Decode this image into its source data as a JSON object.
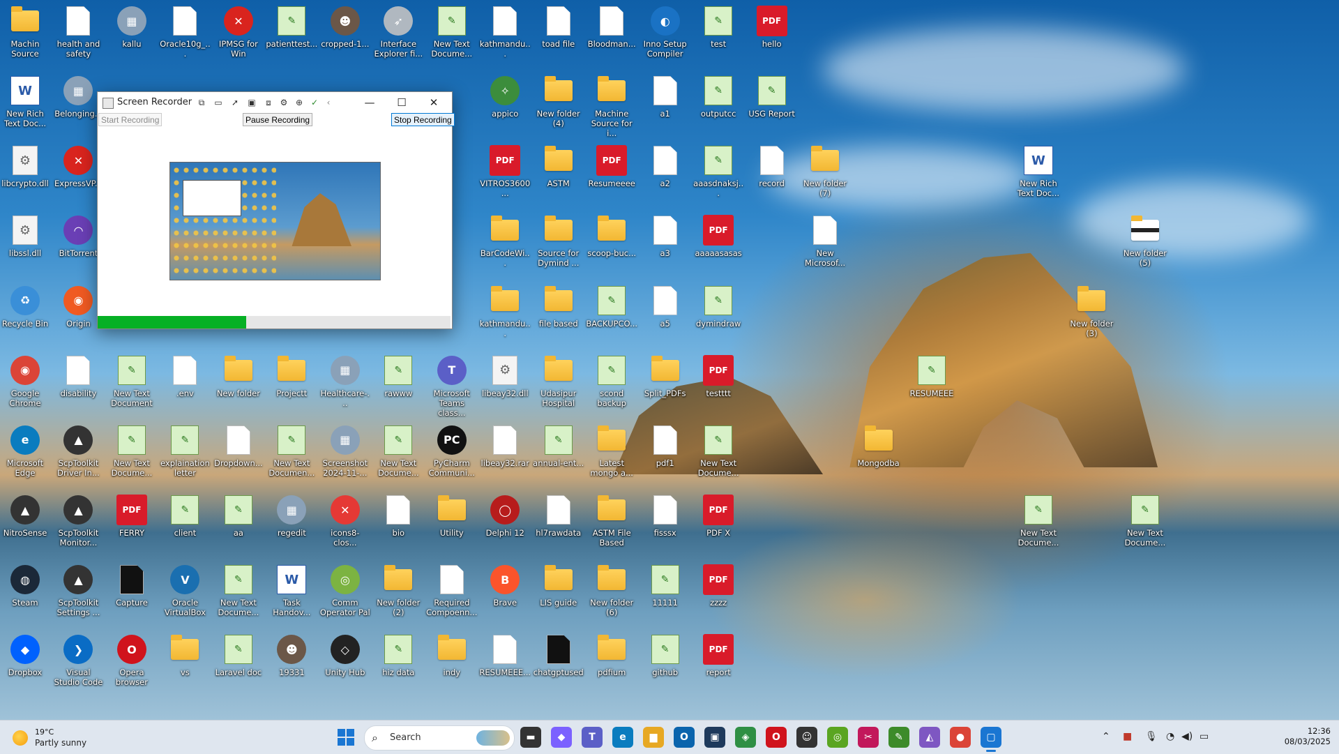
{
  "desktop": {
    "icons": [
      {
        "label": "Machin Source",
        "type": "folder",
        "col": 0,
        "row": 0
      },
      {
        "label": "health and safety",
        "type": "doc",
        "col": 1,
        "row": 0
      },
      {
        "label": "kallu",
        "type": "image",
        "col": 2,
        "row": 0
      },
      {
        "label": "Oracle10g_...",
        "type": "doc",
        "col": 3,
        "row": 0
      },
      {
        "label": "IPMSG for Win",
        "type": "app-red",
        "col": 4,
        "row": 0
      },
      {
        "label": "patienttest...",
        "type": "notepad",
        "col": 5,
        "row": 0
      },
      {
        "label": "cropped-1...",
        "type": "photo",
        "col": 6,
        "row": 0
      },
      {
        "label": "Interface Explorer fi...",
        "type": "rocket",
        "col": 7,
        "row": 0
      },
      {
        "label": "New Text Docume...",
        "type": "notepad",
        "col": 8,
        "row": 0
      },
      {
        "label": "kathmandu...",
        "type": "doc",
        "col": 9,
        "row": 0
      },
      {
        "label": "toad file",
        "type": "window",
        "col": 10,
        "row": 0
      },
      {
        "label": "Bloodman...",
        "type": "window",
        "col": 11,
        "row": 0
      },
      {
        "label": "Inno Setup Compiler",
        "type": "globe",
        "col": 12,
        "row": 0
      },
      {
        "label": "test",
        "type": "notepad",
        "col": 13,
        "row": 0
      },
      {
        "label": "hello",
        "type": "pdf",
        "col": 14,
        "row": 0
      },
      {
        "label": "New Rich Text Doc...",
        "type": "word",
        "col": 0,
        "row": 1
      },
      {
        "label": "Belonging...",
        "type": "image",
        "col": 1,
        "row": 1
      },
      {
        "label": "appico",
        "type": "microscope",
        "col": 9,
        "row": 1
      },
      {
        "label": "New folder (4)",
        "type": "folder",
        "col": 10,
        "row": 1
      },
      {
        "label": "Machine Source for i...",
        "type": "folder",
        "col": 11,
        "row": 1
      },
      {
        "label": "a1",
        "type": "window",
        "col": 12,
        "row": 1
      },
      {
        "label": "outputcc",
        "type": "notepad",
        "col": 13,
        "row": 1
      },
      {
        "label": "USG Report",
        "type": "notepad",
        "col": 14,
        "row": 1
      },
      {
        "label": "libcrypto.dll",
        "type": "gear",
        "col": 0,
        "row": 2
      },
      {
        "label": "ExpressVP...",
        "type": "app-red",
        "col": 1,
        "row": 2
      },
      {
        "label": "VITROS3600...",
        "type": "pdf",
        "col": 9,
        "row": 2
      },
      {
        "label": "ASTM",
        "type": "folder",
        "col": 10,
        "row": 2
      },
      {
        "label": "Resumeeee",
        "type": "pdf",
        "col": 11,
        "row": 2
      },
      {
        "label": "a2",
        "type": "window",
        "col": 12,
        "row": 2
      },
      {
        "label": "aaasdnaksj...",
        "type": "notepad",
        "col": 13,
        "row": 2
      },
      {
        "label": "record",
        "type": "window",
        "col": 14,
        "row": 2
      },
      {
        "label": "New folder (7)",
        "type": "folder",
        "col": 15,
        "row": 2
      },
      {
        "label": "New Rich Text Doc...",
        "type": "word",
        "col": 19,
        "row": 2
      },
      {
        "label": "libssl.dll",
        "type": "gear",
        "col": 0,
        "row": 3
      },
      {
        "label": "BitTorrent",
        "type": "round-purple",
        "col": 1,
        "row": 3
      },
      {
        "label": "BarCodeWi...",
        "type": "folder",
        "col": 9,
        "row": 3
      },
      {
        "label": "Source for Dymind ...",
        "type": "folder",
        "col": 10,
        "row": 3
      },
      {
        "label": "scoop-buc...",
        "type": "folder",
        "col": 11,
        "row": 3
      },
      {
        "label": "a3",
        "type": "window",
        "col": 12,
        "row": 3
      },
      {
        "label": "aaaaasasas",
        "type": "pdf",
        "col": 13,
        "row": 3
      },
      {
        "label": "New Microsof...",
        "type": "doc",
        "col": 15,
        "row": 3
      },
      {
        "label": "New folder (5)",
        "type": "folder-dark",
        "col": 21,
        "row": 3
      },
      {
        "label": "Recycle Bin",
        "type": "recycle",
        "col": 0,
        "row": 4
      },
      {
        "label": "Origin",
        "type": "round-orange",
        "col": 1,
        "row": 4
      },
      {
        "label": "kathmandu...",
        "type": "folder",
        "col": 9,
        "row": 4
      },
      {
        "label": "file based",
        "type": "folder",
        "col": 10,
        "row": 4
      },
      {
        "label": "BACKUPCO...",
        "type": "notepad",
        "col": 11,
        "row": 4
      },
      {
        "label": "a5",
        "type": "window",
        "col": 12,
        "row": 4
      },
      {
        "label": "dymindraw",
        "type": "notepad",
        "col": 13,
        "row": 4
      },
      {
        "label": "New folder (3)",
        "type": "folder",
        "col": 20,
        "row": 4
      },
      {
        "label": "Google Chrome",
        "type": "chrome",
        "col": 0,
        "row": 5
      },
      {
        "label": "disability",
        "type": "doc",
        "col": 1,
        "row": 5
      },
      {
        "label": "New Text Document",
        "type": "notepad",
        "col": 2,
        "row": 5
      },
      {
        "label": ".env",
        "type": "doc",
        "col": 3,
        "row": 5
      },
      {
        "label": "New folder",
        "type": "folder",
        "col": 4,
        "row": 5
      },
      {
        "label": "Projectt",
        "type": "folder",
        "col": 5,
        "row": 5
      },
      {
        "label": "Healthcare-...",
        "type": "image",
        "col": 6,
        "row": 5
      },
      {
        "label": "rawww",
        "type": "notepad",
        "col": 7,
        "row": 5
      },
      {
        "label": "Microsoft Teams class...",
        "type": "teams",
        "col": 8,
        "row": 5
      },
      {
        "label": "libeay32.dll",
        "type": "gear",
        "col": 9,
        "row": 5
      },
      {
        "label": "Udasipur Hospital",
        "type": "folder",
        "col": 10,
        "row": 5
      },
      {
        "label": "scond backup",
        "type": "notepad",
        "col": 11,
        "row": 5
      },
      {
        "label": "Split_PDFs",
        "type": "folder",
        "col": 12,
        "row": 5
      },
      {
        "label": "testttt",
        "type": "pdf",
        "col": 13,
        "row": 5
      },
      {
        "label": "RESUMEEE",
        "type": "notepad",
        "col": 17,
        "row": 5
      },
      {
        "label": "Microsoft Edge",
        "type": "edge",
        "col": 0,
        "row": 6
      },
      {
        "label": "ScpToolkit Driver In...",
        "type": "app-dark",
        "col": 1,
        "row": 6
      },
      {
        "label": "New Text Docume...",
        "type": "notepad",
        "col": 2,
        "row": 6
      },
      {
        "label": "explaination letter",
        "type": "notepad",
        "col": 3,
        "row": 6
      },
      {
        "label": "Dropdown...",
        "type": "doc",
        "col": 4,
        "row": 6
      },
      {
        "label": "New Text Documen...",
        "type": "notepad",
        "col": 5,
        "row": 6
      },
      {
        "label": "Screenshot 2024-11-...",
        "type": "image",
        "col": 6,
        "row": 6
      },
      {
        "label": "New Text Docume...",
        "type": "notepad",
        "col": 7,
        "row": 6
      },
      {
        "label": "PyCharm Communi...",
        "type": "pycharm",
        "col": 8,
        "row": 6
      },
      {
        "label": "libeay32.rar",
        "type": "doc",
        "col": 9,
        "row": 6
      },
      {
        "label": "annual-ent...",
        "type": "notepad",
        "col": 10,
        "row": 6
      },
      {
        "label": "Latest mongo a...",
        "type": "folder",
        "col": 11,
        "row": 6
      },
      {
        "label": "pdf1",
        "type": "window",
        "col": 12,
        "row": 6
      },
      {
        "label": "New Text Docume...",
        "type": "notepad",
        "col": 13,
        "row": 6
      },
      {
        "label": "Mongodba",
        "type": "folder",
        "col": 16,
        "row": 6
      },
      {
        "label": "NitroSense",
        "type": "app-dark",
        "col": 0,
        "row": 7
      },
      {
        "label": "ScpToolkit Monitor...",
        "type": "app-dark",
        "col": 1,
        "row": 7
      },
      {
        "label": "FERRY",
        "type": "pdf",
        "col": 2,
        "row": 7
      },
      {
        "label": "client",
        "type": "notepad",
        "col": 3,
        "row": 7
      },
      {
        "label": "aa",
        "type": "notepad",
        "col": 4,
        "row": 7
      },
      {
        "label": "regedit",
        "type": "image",
        "col": 5,
        "row": 7
      },
      {
        "label": "icons8-clos...",
        "type": "x-red",
        "col": 6,
        "row": 7
      },
      {
        "label": "bio",
        "type": "doc",
        "col": 7,
        "row": 7
      },
      {
        "label": "Utility",
        "type": "folder",
        "col": 8,
        "row": 7
      },
      {
        "label": "Delphi 12",
        "type": "round-red",
        "col": 9,
        "row": 7
      },
      {
        "label": "hl7rawdata",
        "type": "window",
        "col": 10,
        "row": 7
      },
      {
        "label": "ASTM File Based",
        "type": "folder",
        "col": 11,
        "row": 7
      },
      {
        "label": "fisssx",
        "type": "window",
        "col": 12,
        "row": 7
      },
      {
        "label": "PDF X",
        "type": "pdf",
        "col": 13,
        "row": 7
      },
      {
        "label": "New Text Docume...",
        "type": "notepad",
        "col": 19,
        "row": 7
      },
      {
        "label": "New Text Docume...",
        "type": "notepad",
        "col": 21,
        "row": 7
      },
      {
        "label": "Steam",
        "type": "round-blue",
        "col": 0,
        "row": 8
      },
      {
        "label": "ScpToolkit Settings ...",
        "type": "app-dark",
        "col": 1,
        "row": 8
      },
      {
        "label": "Capture",
        "type": "window-dark",
        "col": 2,
        "row": 8
      },
      {
        "label": "Oracle VirtualBox",
        "type": "vbox",
        "col": 3,
        "row": 8
      },
      {
        "label": "New Text Docume...",
        "type": "notepad",
        "col": 4,
        "row": 8
      },
      {
        "label": "Task Handov...",
        "type": "word",
        "col": 5,
        "row": 8
      },
      {
        "label": "Comm Operator Pal",
        "type": "round-green",
        "col": 6,
        "row": 8
      },
      {
        "label": "New folder (2)",
        "type": "folder",
        "col": 7,
        "row": 8
      },
      {
        "label": "Required Compoenn...",
        "type": "doc",
        "col": 8,
        "row": 8
      },
      {
        "label": "Brave",
        "type": "brave",
        "col": 9,
        "row": 8
      },
      {
        "label": "LIS guide",
        "type": "folder",
        "col": 10,
        "row": 8
      },
      {
        "label": "New folder (6)",
        "type": "folder",
        "col": 11,
        "row": 8
      },
      {
        "label": "11111",
        "type": "notepad",
        "col": 12,
        "row": 8
      },
      {
        "label": "zzzz",
        "type": "pdf",
        "col": 13,
        "row": 8
      },
      {
        "label": "Dropbox",
        "type": "dropbox",
        "col": 0,
        "row": 9
      },
      {
        "label": "Visual Studio Code",
        "type": "vscode",
        "col": 1,
        "row": 9
      },
      {
        "label": "Opera browser",
        "type": "opera",
        "col": 2,
        "row": 9
      },
      {
        "label": "vs",
        "type": "folder",
        "col": 3,
        "row": 9
      },
      {
        "label": "Laravel doc",
        "type": "notepad",
        "col": 4,
        "row": 9
      },
      {
        "label": "19331",
        "type": "photo",
        "col": 5,
        "row": 9
      },
      {
        "label": "Unity Hub",
        "type": "unity",
        "col": 6,
        "row": 9
      },
      {
        "label": "hiz data",
        "type": "notepad",
        "col": 7,
        "row": 9
      },
      {
        "label": "indy",
        "type": "folder",
        "col": 8,
        "row": 9
      },
      {
        "label": "RESUMEEE...",
        "type": "doc",
        "col": 9,
        "row": 9
      },
      {
        "label": "chatgptused",
        "type": "window-dark",
        "col": 10,
        "row": 9
      },
      {
        "label": "pdfium",
        "type": "folder",
        "col": 11,
        "row": 9
      },
      {
        "label": "github",
        "type": "notepad",
        "col": 12,
        "row": 9
      },
      {
        "label": "report",
        "type": "pdf",
        "col": 13,
        "row": 9
      }
    ]
  },
  "recorder": {
    "title": "Screen Recorder",
    "start_label": "Start Recording",
    "pause_label": "Pause Recording",
    "stop_label": "Stop Recording",
    "progress": 0.42,
    "window_controls": {
      "minimize": "—",
      "maximize": "☐",
      "close": "✕"
    }
  },
  "taskbar": {
    "weather": {
      "temp": "19°C",
      "desc": "Partly sunny"
    },
    "search_label": "Search",
    "apps": [
      {
        "name": "file-explorer-task",
        "glyph": "▬",
        "color": "#333"
      },
      {
        "name": "copilot-task",
        "glyph": "◆",
        "color": "#7b61ff"
      },
      {
        "name": "teams-task",
        "glyph": "T",
        "color": "#5b5fc7"
      },
      {
        "name": "edge-task",
        "glyph": "e",
        "color": "#0a7cbf"
      },
      {
        "name": "folder-task",
        "glyph": "▆",
        "color": "#e7a823"
      },
      {
        "name": "outlook-task",
        "glyph": "O",
        "color": "#0a64ad"
      },
      {
        "name": "terminal-task",
        "glyph": "▣",
        "color": "#1e3a5c"
      },
      {
        "name": "m365-task",
        "glyph": "◈",
        "color": "#2f8f44"
      },
      {
        "name": "opera-task",
        "glyph": "O",
        "color": "#d0131c"
      },
      {
        "name": "app-task",
        "glyph": "☺",
        "color": "#333"
      },
      {
        "name": "green-app-task",
        "glyph": "◎",
        "color": "#5aa521"
      },
      {
        "name": "snip-task",
        "glyph": "✂",
        "color": "#c2185b"
      },
      {
        "name": "notepad-task",
        "glyph": "✎",
        "color": "#3d8b2a"
      },
      {
        "name": "vs-task",
        "glyph": "◭",
        "color": "#7e57c2"
      },
      {
        "name": "chrome-task",
        "glyph": "●",
        "color": "#db4437"
      },
      {
        "name": "recorder-task",
        "glyph": "▢",
        "color": "#1a76d2"
      }
    ],
    "clock": {
      "time": "12:36",
      "date": "08/03/2025"
    }
  }
}
